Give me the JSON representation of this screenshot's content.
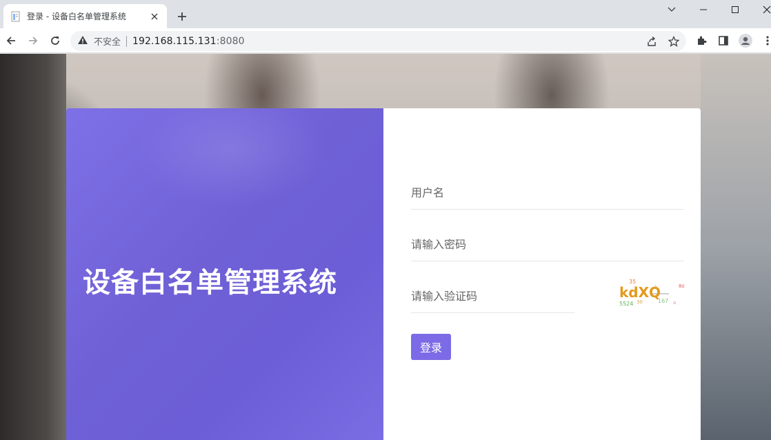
{
  "browser": {
    "tab": {
      "title": "登录 - 设备白名单管理系统",
      "favicon": "page-icon"
    },
    "security_label": "不安全",
    "url_host": "192.168.115.131",
    "url_port": ":8080",
    "icons": [
      "back-icon",
      "forward-icon",
      "reload-icon",
      "share-icon",
      "bookmark-star-icon",
      "extensions-icon",
      "side-panel-icon",
      "profile-icon",
      "menu-icon"
    ]
  },
  "page": {
    "brand_title": "设备白名单管理系统",
    "username_placeholder": "用户名",
    "password_placeholder": "请输入密码",
    "captcha_placeholder": "请输入验证码",
    "captcha_text": "kdXQ",
    "login_label": "登录"
  },
  "colors": {
    "accent": "#7c6be6",
    "panel": "#6f60d6"
  }
}
